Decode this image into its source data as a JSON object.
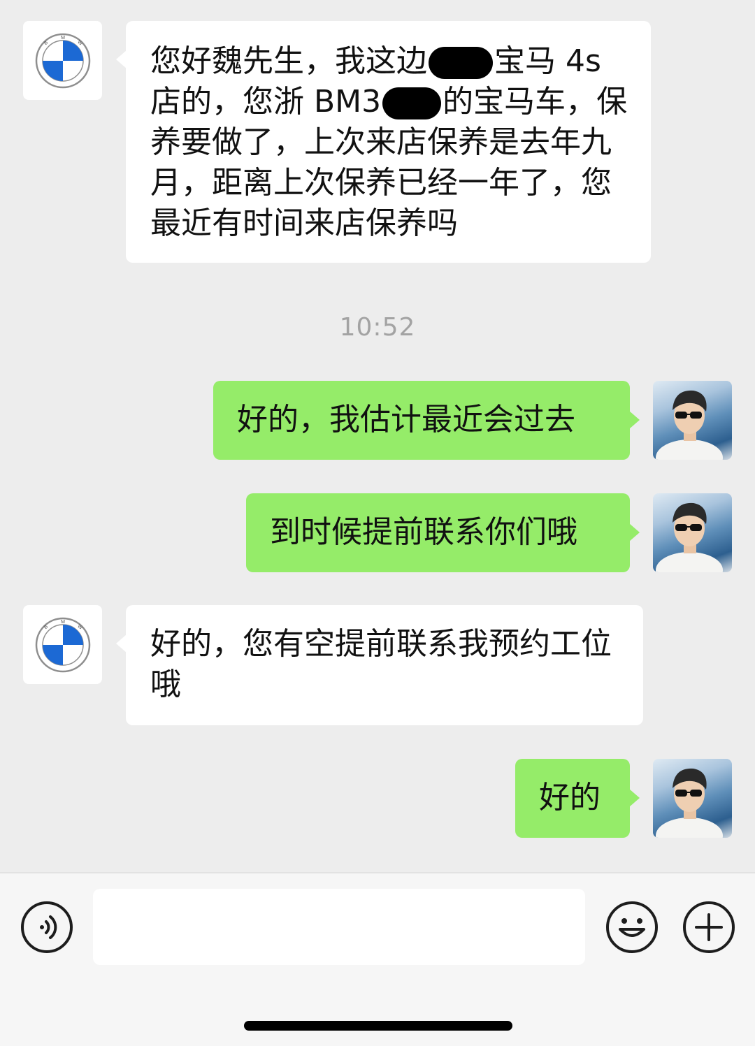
{
  "messages": [
    {
      "sender": "BMW",
      "segments": {
        "t1": "您好魏先生，我这边",
        "t2": "宝马 4s 店的，您浙 BM3",
        "t3": "的宝马车，保养要做了，上次来店保养是去年九月，距离上次保养已经一年了，您最近有时间来店保养吗"
      }
    },
    {
      "sender": "me",
      "text": "好的，我估计最近会过去"
    },
    {
      "sender": "me",
      "text": "到时候提前联系你们哦"
    },
    {
      "sender": "BMW",
      "text": "好的，您有空提前联系我预约工位哦"
    },
    {
      "sender": "me",
      "text": "好的"
    }
  ],
  "timestamp": "10:52",
  "bmw_logo": {
    "letters": "BMW",
    "colors": {
      "blue": "#1c69d4",
      "white": "#ffffff",
      "ring": "#9a9a9a"
    }
  },
  "icons": {
    "voice": "voice-input-icon",
    "emoji": "emoji-icon",
    "plus": "plus-icon"
  },
  "colors": {
    "outgoing_bubble": "#95ec69",
    "incoming_bubble": "#ffffff",
    "background": "#ededed"
  }
}
